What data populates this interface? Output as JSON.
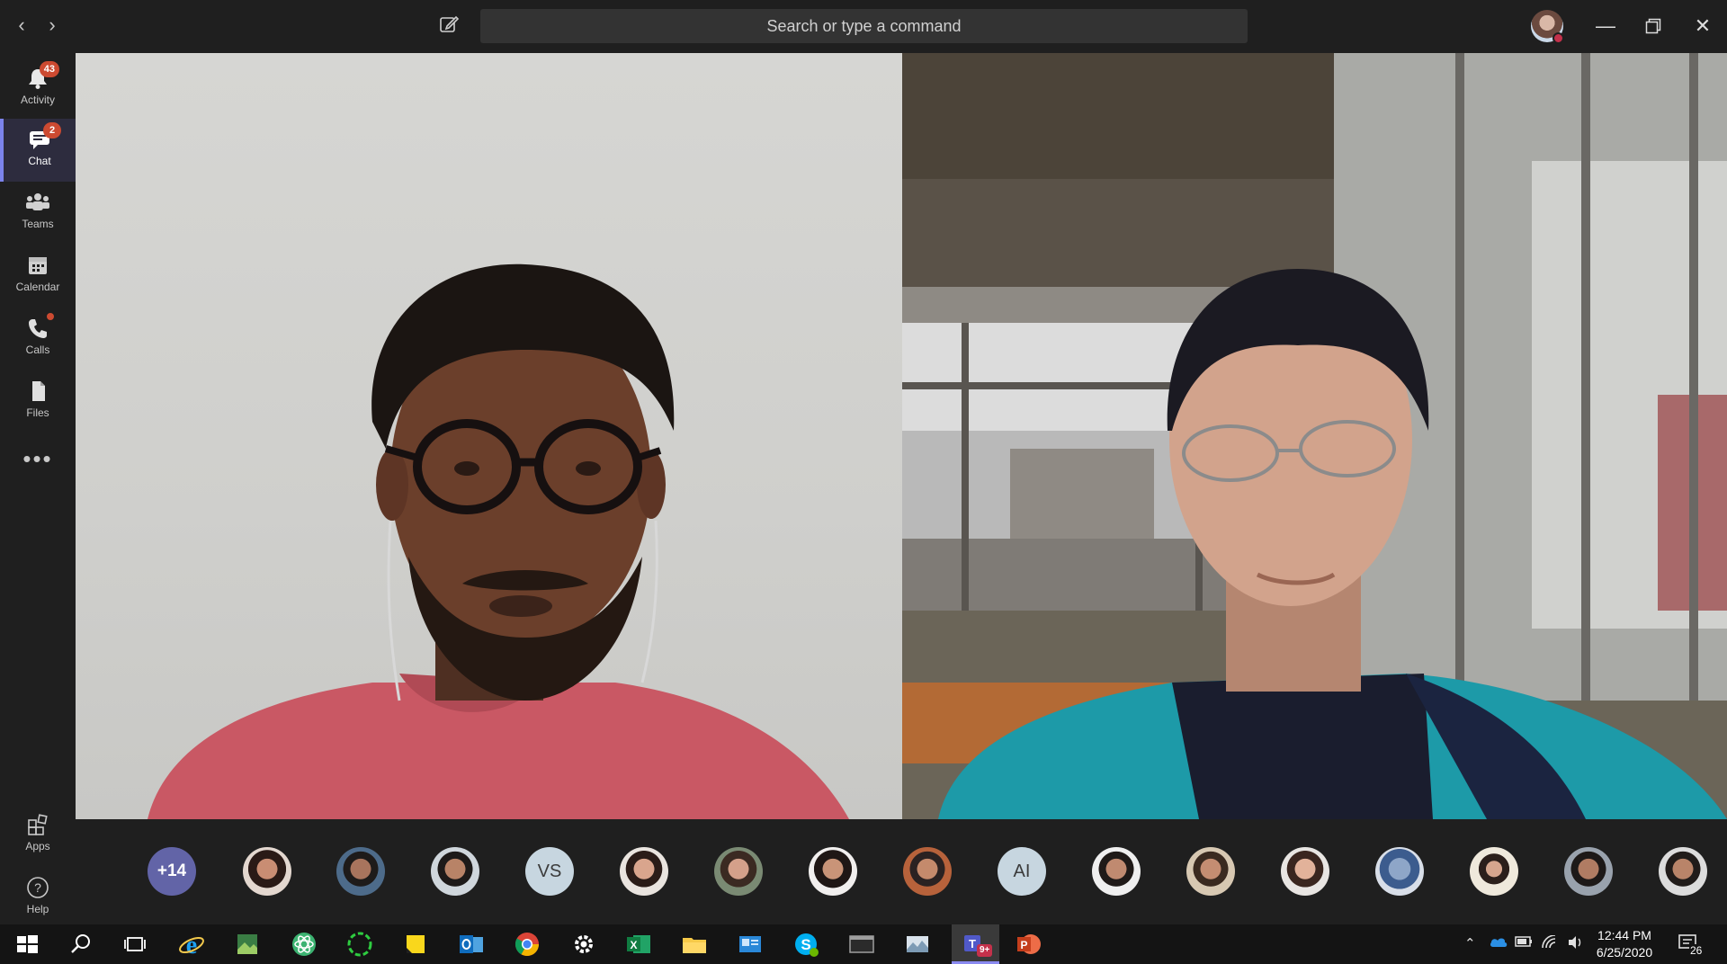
{
  "titlebar": {
    "search_placeholder": "Search or type a command"
  },
  "rail": {
    "items": [
      {
        "label": "Activity",
        "badge": "43"
      },
      {
        "label": "Chat",
        "badge": "2"
      },
      {
        "label": "Teams"
      },
      {
        "label": "Calendar"
      },
      {
        "label": "Calls"
      },
      {
        "label": "Files"
      }
    ],
    "bottom": [
      {
        "label": "Apps"
      },
      {
        "label": "Help"
      }
    ]
  },
  "participants": {
    "overflow": "+14",
    "initials_1": "VS",
    "initials_2": "AI"
  },
  "taskbar": {
    "time": "12:44 PM",
    "date": "6/25/2020",
    "notifications": "26",
    "teams_badge": "9+"
  },
  "colors": {
    "accent": "#6264a7",
    "badge": "#cc4a31",
    "rail_bg": "#1f1f1f"
  }
}
